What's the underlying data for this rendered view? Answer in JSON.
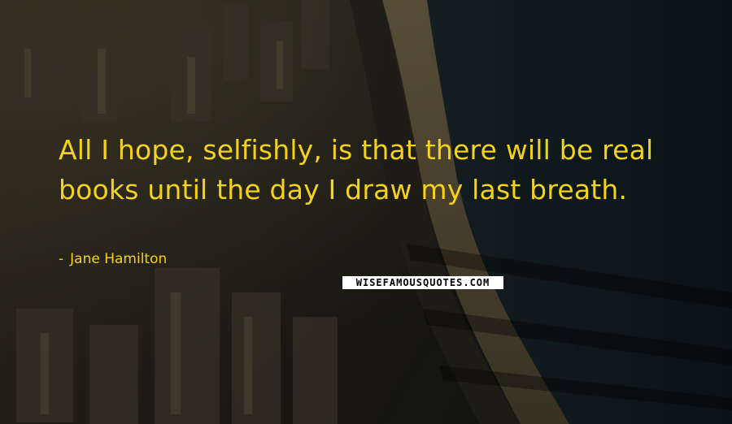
{
  "quote": {
    "text": "All I hope, selfishly, is that there will be real books until the day I draw my last breath.",
    "author": "Jane Hamilton",
    "dash": "-"
  },
  "watermark": {
    "text": "WISEFAMOUSQUOTES.COM"
  },
  "colors": {
    "text": "#f5d21a",
    "watermark_bg": "#ffffff",
    "watermark_fg": "#000000"
  }
}
